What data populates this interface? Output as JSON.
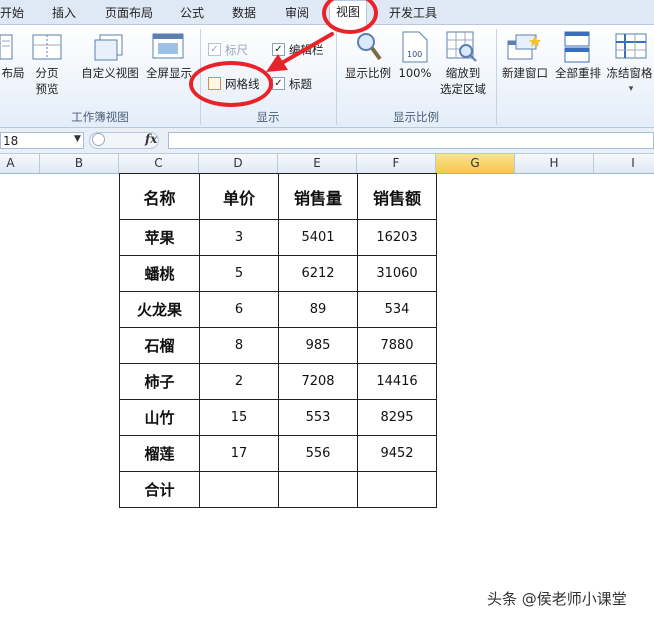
{
  "tabs": [
    "开始",
    "插入",
    "页面布局",
    "公式",
    "数据",
    "审阅",
    "视图",
    "开发工具"
  ],
  "ribbon": {
    "workbook_views": {
      "buttons": [
        "布局",
        "分页\n预览",
        "自定义视图",
        "全屏显示"
      ],
      "group_label": "工作簿视图"
    },
    "show": {
      "checkboxes": [
        {
          "label": "标尺",
          "checked": true,
          "enabled": false
        },
        {
          "label": "编辑栏",
          "checked": true,
          "enabled": true
        },
        {
          "label": "网格线",
          "checked": false,
          "enabled": true
        },
        {
          "label": "标题",
          "checked": true,
          "enabled": true
        }
      ],
      "group_label": "显示"
    },
    "zoom": {
      "buttons": [
        "显示比例",
        "100%",
        "缩放到\n选定区域"
      ],
      "group_label": "显示比例"
    },
    "window": {
      "buttons": [
        "新建窗口",
        "全部重排",
        "冻结窗格"
      ]
    }
  },
  "formula_bar": {
    "name_box": "18",
    "fx_label": "fx",
    "value": ""
  },
  "columns": [
    "A",
    "B",
    "C",
    "D",
    "E",
    "F",
    "G",
    "H",
    "I"
  ],
  "selected_column": "G",
  "table": {
    "headers": [
      "名称",
      "单价",
      "销售量",
      "销售额"
    ],
    "rows": [
      [
        "苹果",
        "3",
        "5401",
        "16203"
      ],
      [
        "蟠桃",
        "5",
        "6212",
        "31060"
      ],
      [
        "火龙果",
        "6",
        "89",
        "534"
      ],
      [
        "石榴",
        "8",
        "985",
        "7880"
      ],
      [
        "柿子",
        "2",
        "7208",
        "14416"
      ],
      [
        "山竹",
        "15",
        "553",
        "8295"
      ],
      [
        "榴莲",
        "17",
        "556",
        "9452"
      ],
      [
        "合计",
        "",
        "",
        ""
      ]
    ]
  },
  "annotation_color": "#e8242a",
  "watermark": "头条 @侯老师小课堂"
}
